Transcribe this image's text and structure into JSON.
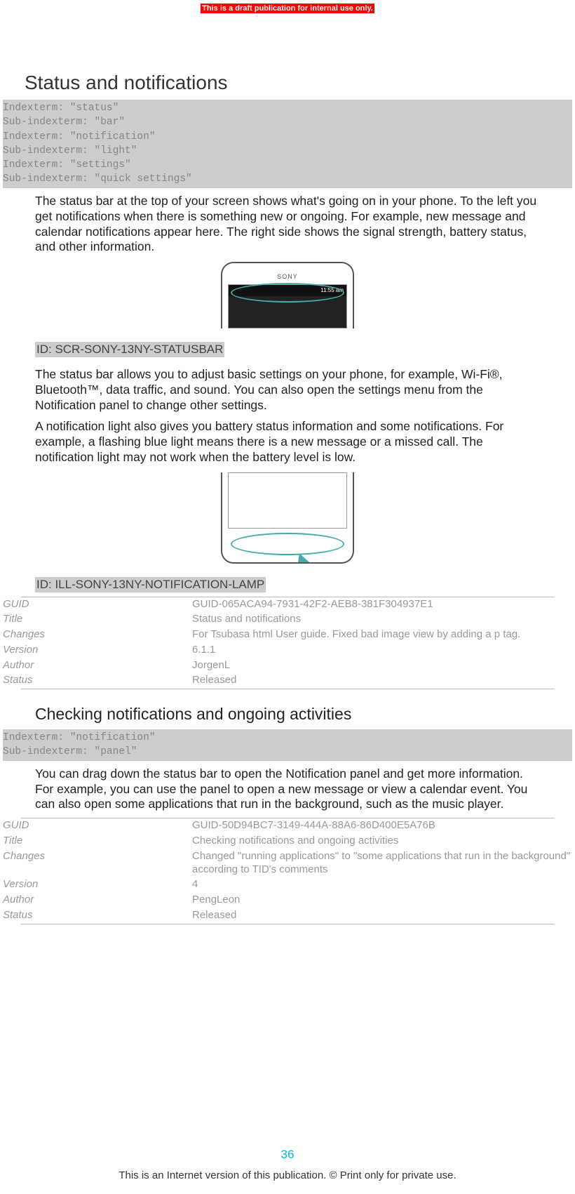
{
  "banner": "This is a draft publication for internal use only.",
  "heading": "Status and notifications",
  "indexterms1": "Indexterm: \"status\"\nSub-indexterm: \"bar\"\nIndexterm: \"notification\"\nSub-indexterm: \"light\"\nIndexterm: \"settings\"\nSub-indexterm: \"quick settings\"",
  "para1": "The status bar at the top of your screen shows what's going on in your phone. To the left you get notifications when there is something new or ongoing. For example, new message and calendar notifications appear here. The right side shows the signal strength, battery status, and other information.",
  "img1_status_time": "11:55 am",
  "img1_logo": "SONY",
  "id1": "ID: SCR-SONY-13NY-STATUSBAR",
  "para2": "The status bar allows you to adjust basic settings on your phone, for example, Wi‑Fi®, Bluetooth™, data traffic, and sound. You can also open the settings menu from the Notification panel to change other settings.",
  "para3": "A notification light also gives you battery status information and some notifications. For example, a flashing blue light means there is a new message or a missed call. The notification light may not work when the battery level is low.",
  "id2": "ID: ILL-SONY-13NY-NOTIFICATION-LAMP",
  "meta1": {
    "guid_k": "GUID",
    "guid_v": "GUID-065ACA94-7931-42F2-AEB8-381F304937E1",
    "title_k": "Title",
    "title_v": "Status and notifications",
    "changes_k": "Changes",
    "changes_v": "For Tsubasa html User guide. Fixed bad image view by adding a p tag.",
    "version_k": "Version",
    "version_v": "6.1.1",
    "author_k": "Author",
    "author_v": "JorgenL",
    "status_k": "Status",
    "status_v": "Released"
  },
  "heading2": "Checking notifications and ongoing activities",
  "indexterms2": "Indexterm: \"notification\"\nSub-indexterm: \"panel\"",
  "para4": "You can drag down the status bar to open the Notification panel and get more information. For example, you can use the panel to open a new message or view a calendar event. You can also open some applications that run in the background, such as the music player.",
  "meta2": {
    "guid_k": "GUID",
    "guid_v": "GUID-50D94BC7-3149-444A-88A6-86D400E5A76B",
    "title_k": "Title",
    "title_v": "Checking notifications and ongoing activities",
    "changes_k": "Changes",
    "changes_v": "Changed \"running applications\" to \"some applications that run in the background\" according to TID's comments",
    "version_k": "Version",
    "version_v": "4",
    "author_k": "Author",
    "author_v": "PengLeon",
    "status_k": "Status",
    "status_v": "Released"
  },
  "page_number": "36",
  "footer": "This is an Internet version of this publication. © Print only for private use."
}
